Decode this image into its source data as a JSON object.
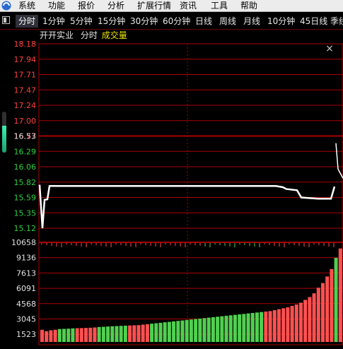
{
  "menu": {
    "items": [
      "系统",
      "功能",
      "报价",
      "分析",
      "扩展行情",
      "资讯",
      "工具",
      "帮助"
    ]
  },
  "period_tabs": {
    "items": [
      "分时",
      "1分钟",
      "5分钟",
      "15分钟",
      "30分钟",
      "60分钟",
      "日线",
      "周线",
      "月线",
      "10分钟",
      "45日线",
      "季线"
    ],
    "active": "分时"
  },
  "stock_header": {
    "name": "开开实业",
    "mode": "分时",
    "indicator": "成交量"
  },
  "close_button": "×",
  "side_gauge": {
    "level": 0.65
  },
  "colors": {
    "background": "#000000",
    "grid_red": "#a80000",
    "price_up": "#ff4040",
    "price_down": "#30d040",
    "price_line": "#ffffff",
    "vol_up": "#ff5050",
    "vol_down": "#50d050",
    "indicator": "#e8e000"
  },
  "chart_data": [
    {
      "type": "line",
      "name": "price",
      "y_ticks_upper": [
        "18.18",
        "17.94",
        "17.71",
        "17.47",
        "17.24",
        "17.00",
        "16.77"
      ],
      "y_ticks_lower": [
        "16.53",
        "16.29",
        "16.06",
        "15.82",
        "15.59",
        "15.35",
        "15.12"
      ],
      "reference_price": 16.53,
      "ylim": [
        15.12,
        18.18
      ],
      "x_index": [
        0,
        1,
        2,
        3,
        4,
        5,
        6,
        7,
        8,
        9,
        10,
        11,
        12,
        13,
        14,
        15,
        16,
        17,
        18,
        19,
        20,
        21,
        22
      ],
      "values": [
        15.84,
        15.12,
        15.59,
        15.6,
        15.82,
        15.82,
        15.82,
        15.82,
        15.82,
        15.82,
        15.82,
        15.82,
        15.82,
        15.82,
        15.82,
        15.81,
        15.8,
        15.77,
        15.75,
        15.63,
        15.61,
        15.61,
        15.81
      ],
      "after_open_marker": [
        16.53,
        16.1
      ]
    },
    {
      "type": "bar",
      "name": "volume",
      "y_ticks": [
        "10658",
        "9136",
        "7613",
        "6091",
        "4568",
        "3045",
        "1523"
      ],
      "ylim": [
        0,
        10658
      ],
      "values_left_to_right": [
        1300,
        1150,
        1250,
        1300,
        1380,
        1400,
        1420,
        1450,
        1470,
        1480,
        1500,
        1520,
        1550,
        1600,
        1620,
        1650,
        1680,
        1700,
        1720,
        1740,
        1760,
        1780,
        1800,
        1850,
        1900,
        1950,
        2000,
        2050,
        2100,
        2150,
        2200,
        2250,
        2300,
        2350,
        2400,
        2450,
        2500,
        2550,
        2600,
        2650,
        2700,
        2750,
        2800,
        2850,
        2900,
        2950,
        3000,
        3050,
        3100,
        3150,
        3200,
        3250,
        3300,
        3400,
        3500,
        3600,
        3700,
        3850,
        4000,
        4200,
        4500,
        4800,
        5200,
        5800,
        6300,
        7000,
        7800,
        9000,
        10000
      ],
      "direction_left_to_right": "rrrrggggrrrrrgggggggrrrrrggggggggggggggggggggggggggrrrrrrrrrrrrrrrrg"
    }
  ]
}
